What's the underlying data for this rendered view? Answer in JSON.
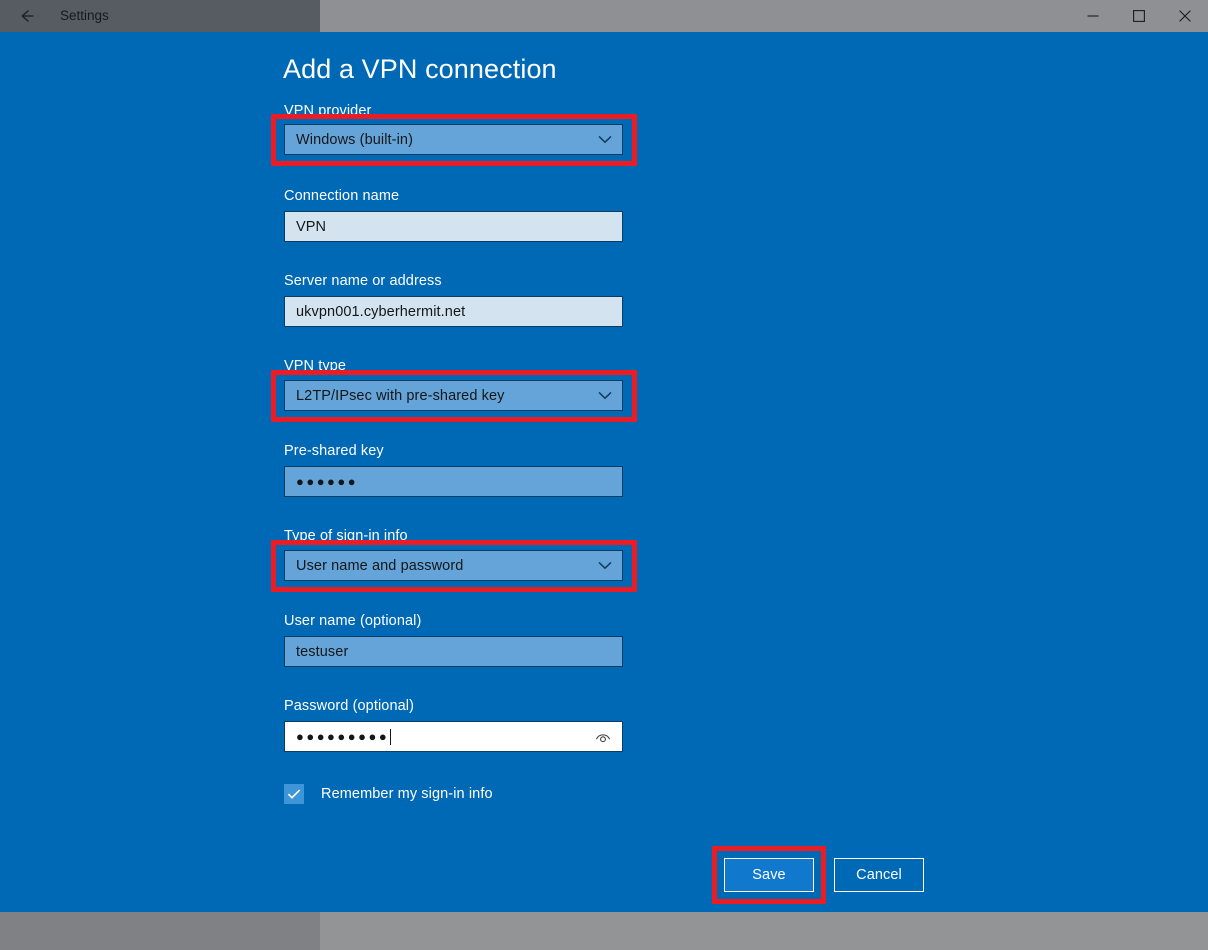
{
  "window": {
    "title": "Settings",
    "back_icon": "back-arrow-icon",
    "controls": [
      {
        "name": "minimize-button",
        "glyph": "minimize-icon"
      },
      {
        "name": "maximize-button",
        "glyph": "maximize-icon"
      },
      {
        "name": "close-button",
        "glyph": "close-icon"
      }
    ]
  },
  "page": {
    "title": "Add a VPN connection"
  },
  "fields": {
    "vpn_provider": {
      "label": "VPN provider",
      "value": "Windows (built-in)",
      "type": "dropdown",
      "highlighted": true
    },
    "connection_name": {
      "label": "Connection name",
      "value": "VPN",
      "type": "text",
      "highlighted": false
    },
    "server_name": {
      "label": "Server name or address",
      "value": "ukvpn001.cyberhermit.net",
      "type": "text",
      "highlighted": false
    },
    "vpn_type": {
      "label": "VPN type",
      "value": "L2TP/IPsec with pre-shared key",
      "type": "dropdown",
      "highlighted": true
    },
    "pre_shared_key": {
      "label": "Pre-shared key",
      "value": "●●●●●●",
      "type": "password",
      "highlighted": false
    },
    "signin_type": {
      "label": "Type of sign-in info",
      "value": "User name and password",
      "type": "dropdown",
      "highlighted": true
    },
    "user_name": {
      "label": "User name (optional)",
      "value": "testuser",
      "type": "text",
      "highlighted": false
    },
    "password": {
      "label": "Password (optional)",
      "value": "●●●●●●●●●",
      "type": "password",
      "reveal_icon": "eye-reveal-icon",
      "focused": true,
      "highlighted": false
    }
  },
  "remember": {
    "label": "Remember my sign-in info",
    "checked": true
  },
  "buttons": {
    "save": "Save",
    "cancel": "Cancel",
    "save_highlighted": true
  },
  "colors": {
    "page_background": "#0069b5",
    "accent_button": "#1179cd",
    "annotation_red": "#ec1c24",
    "control_blue": "#64a4d8",
    "input_light": "#d3e3f0",
    "titlebar_active": "#565c62",
    "titlebar_inactive": "#8e9094"
  }
}
